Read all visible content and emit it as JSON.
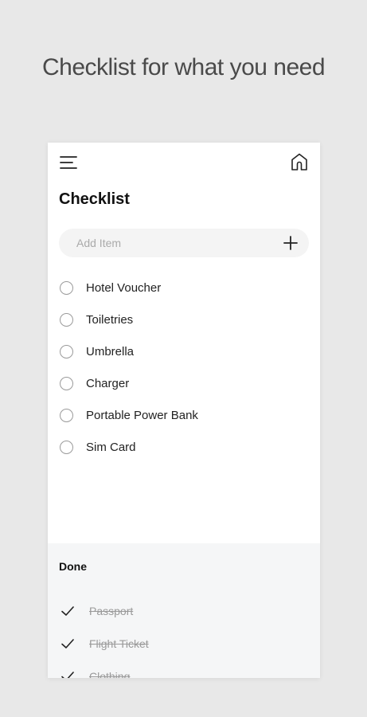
{
  "headline": "Checklist for what you need",
  "app": {
    "title": "Checklist",
    "add_item": {
      "placeholder": "Add Item"
    },
    "items": [
      {
        "label": "Hotel Voucher"
      },
      {
        "label": "Toiletries"
      },
      {
        "label": "Umbrella"
      },
      {
        "label": "Charger"
      },
      {
        "label": "Portable Power Bank"
      },
      {
        "label": "Sim Card"
      }
    ],
    "done": {
      "title": "Done",
      "items": [
        {
          "label": "Passport"
        },
        {
          "label": "Flight Ticket"
        },
        {
          "label": "Clothing"
        }
      ]
    }
  },
  "icons": {
    "menu": "menu-icon",
    "home": "home-icon",
    "add": "plus-icon",
    "unchecked": "circle-icon",
    "checked": "check-icon"
  },
  "colors": {
    "background": "#e8e8e8",
    "card": "#ffffff",
    "done_background": "#f5f6f7",
    "input_background": "#f4f4f4"
  }
}
